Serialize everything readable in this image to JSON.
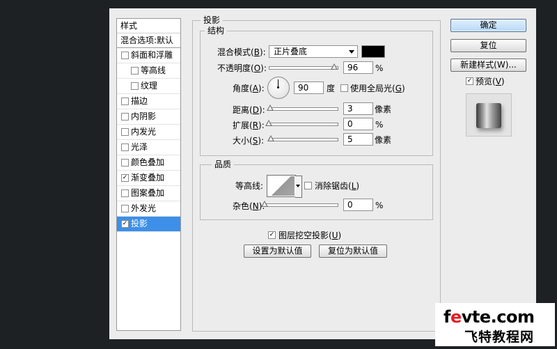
{
  "styles_panel": {
    "header": "样式",
    "blend_options": "混合选项:默认",
    "items": [
      {
        "label": "斜面和浮雕",
        "checked": false,
        "indent": false,
        "selected": false
      },
      {
        "label": "等高线",
        "checked": false,
        "indent": true,
        "selected": false
      },
      {
        "label": "纹理",
        "checked": false,
        "indent": true,
        "selected": false
      },
      {
        "label": "描边",
        "checked": false,
        "indent": false,
        "selected": false
      },
      {
        "label": "内阴影",
        "checked": false,
        "indent": false,
        "selected": false
      },
      {
        "label": "内发光",
        "checked": false,
        "indent": false,
        "selected": false
      },
      {
        "label": "光泽",
        "checked": false,
        "indent": false,
        "selected": false
      },
      {
        "label": "颜色叠加",
        "checked": false,
        "indent": false,
        "selected": false
      },
      {
        "label": "渐变叠加",
        "checked": true,
        "indent": false,
        "selected": false
      },
      {
        "label": "图案叠加",
        "checked": false,
        "indent": false,
        "selected": false
      },
      {
        "label": "外发光",
        "checked": false,
        "indent": false,
        "selected": false
      },
      {
        "label": "投影",
        "checked": true,
        "indent": false,
        "selected": true
      }
    ]
  },
  "drop_shadow": {
    "title": "投影",
    "structure": {
      "title": "结构",
      "blend_mode_label": "混合模式",
      "blend_mode_key": "B",
      "blend_mode_value": "正片叠底",
      "color": "#000000",
      "opacity_label": "不透明度",
      "opacity_key": "O",
      "opacity_value": "96",
      "opacity_fraction": 0.96,
      "percent": "%",
      "angle_label": "角度",
      "angle_key": "A",
      "angle_value": "90",
      "angle_unit": "度",
      "global_light_label": "使用全局光",
      "global_light_key": "G",
      "global_light_checked": false,
      "distance_label": "距离",
      "distance_key": "D",
      "distance_value": "3",
      "distance_fraction": 0.02,
      "pixels": "像素",
      "spread_label": "扩展",
      "spread_key": "R",
      "spread_value": "0",
      "spread_fraction": 0.0,
      "size_label": "大小",
      "size_key": "S",
      "size_value": "5",
      "size_fraction": 0.03
    },
    "quality": {
      "title": "品质",
      "contour_label": "等高线:",
      "anti_alias_label": "消除锯齿",
      "anti_alias_key": "L",
      "anti_alias_checked": false,
      "noise_label": "杂色",
      "noise_key": "N",
      "noise_value": "0",
      "noise_fraction": 0.0,
      "percent": "%"
    },
    "knockout_label": "图层挖空投影",
    "knockout_key": "U",
    "knockout_checked": true,
    "make_default": "设置为默认值",
    "reset_default": "复位为默认值"
  },
  "buttons": {
    "ok": "确定",
    "reset": "复位",
    "new_style": "新建样式(W)...",
    "preview_label": "预览",
    "preview_key": "V",
    "preview_checked": true
  },
  "watermark": {
    "line1_a": "f",
    "line1_b": "e",
    "line1_c": "vte.com",
    "line2": "飞特教程网"
  }
}
